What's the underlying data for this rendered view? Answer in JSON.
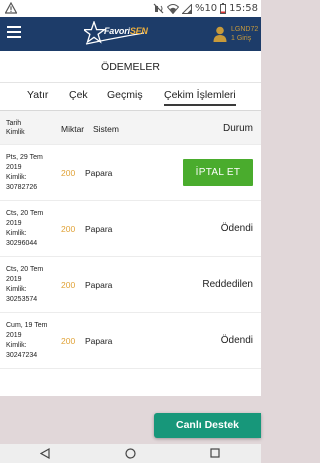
{
  "status_bar": {
    "battery": "%10",
    "time": "15:58"
  },
  "app_bar": {
    "logo_part1": "Favori",
    "logo_part2": "SEN",
    "user_line1": "LGND72",
    "user_line2": "1 Giriş"
  },
  "page": {
    "title": "ÖDEMELER"
  },
  "tabs": [
    {
      "label": "Yatır",
      "active": false
    },
    {
      "label": "Çek",
      "active": false
    },
    {
      "label": "Geçmiş",
      "active": false
    },
    {
      "label": "Çekim İşlemleri",
      "active": true
    }
  ],
  "table": {
    "headers": {
      "date_line1": "Tarih",
      "date_line2": "Kimlik",
      "amount": "Miktar",
      "system": "Sistem",
      "status": "Durum"
    },
    "rows": [
      {
        "date_line1": "Pts, 29 Tem",
        "date_line2": "2019",
        "id_label": "Kimlik:",
        "id": "30782726",
        "amount": "200",
        "system": "Papara",
        "status": "",
        "action": "İPTAL ET"
      },
      {
        "date_line1": "Cts, 20 Tem",
        "date_line2": "2019",
        "id_label": "Kimlik:",
        "id": "30296044",
        "amount": "200",
        "system": "Papara",
        "status": "Ödendi",
        "action": ""
      },
      {
        "date_line1": "Cts, 20 Tem",
        "date_line2": "2019",
        "id_label": "Kimlik:",
        "id": "30253574",
        "amount": "200",
        "system": "Papara",
        "status": "Reddedilen",
        "action": ""
      },
      {
        "date_line1": "Cum, 19 Tem",
        "date_line2": "2019",
        "id_label": "Kimlik:",
        "id": "30247234",
        "amount": "200",
        "system": "Papara",
        "status": "Ödendi",
        "action": ""
      }
    ]
  },
  "support": {
    "label": "Canlı Destek"
  },
  "colors": {
    "app_bar": "#1d3c69",
    "cancel_button": "#4aac2d",
    "support_button": "#17977a",
    "amount": "#e0a237",
    "background": "#e1d7d9"
  }
}
